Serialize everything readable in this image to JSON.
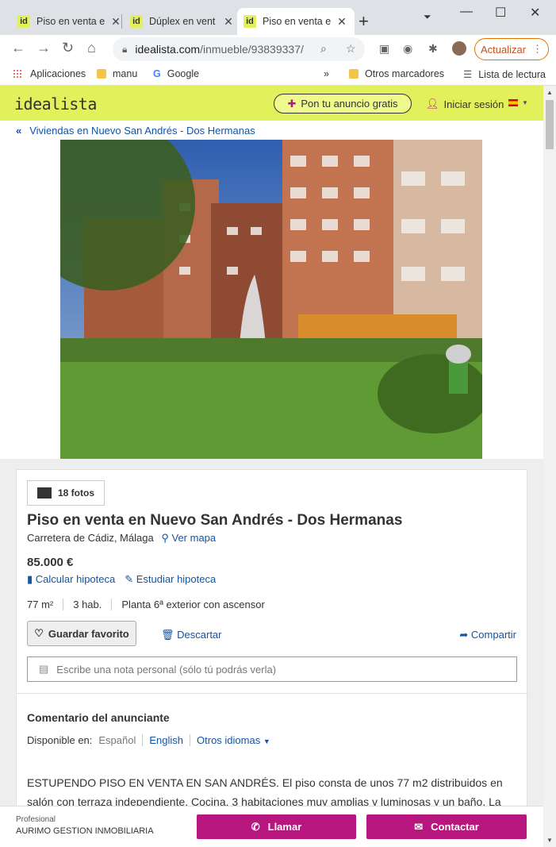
{
  "browser": {
    "tabs": [
      {
        "title": "Piso en venta e",
        "favicon": "id"
      },
      {
        "title": "Dúplex en vent",
        "favicon": "id"
      },
      {
        "title": "Piso en venta e",
        "favicon": "id"
      }
    ],
    "url_domain": "idealista.com",
    "url_path": "/inmueble/93839337/",
    "update_label": "Actualizar",
    "bookmarks": {
      "apps": "Aplicaciones",
      "manu": "manu",
      "google": "Google",
      "more": "»",
      "others": "Otros marcadores",
      "reading": "Lista de lectura"
    }
  },
  "site": {
    "logo": "idealista",
    "publish_ad": "Pon tu anuncio gratis",
    "login": "Iniciar sesión",
    "brand_color": "#e1f05b",
    "accent_color": "#b6167d"
  },
  "breadcrumb": "Viviendas en Nuevo San Andrés - Dos Hermanas",
  "listing": {
    "photos": "18 fotos",
    "title": "Piso en venta en Nuevo San Andrés - Dos Hermanas",
    "address": "Carretera de Cádiz, Málaga",
    "map_link": "Ver mapa",
    "price": "85.000 €",
    "calc_mortgage": "Calcular hipoteca",
    "study_mortgage": "Estudiar hipoteca",
    "features": [
      "77 m²",
      "3 hab.",
      "Planta 6ª exterior con ascensor"
    ],
    "save_favorite": "Guardar favorito",
    "discard": "Descartar",
    "share": "Compartir",
    "note_placeholder": "Escribe una nota personal (sólo tú podrás verla)",
    "comment_title": "Comentario del anunciante",
    "available_in": "Disponible en:",
    "lang_es": "Español",
    "lang_en": "English",
    "lang_other": "Otros idiomas",
    "description": "ESTUPENDO PISO EN VENTA EN SAN ANDRÉS. El piso consta de unos 77 m2 distribuidos en salón con terraza independiente. Cocina, 3 habitaciones muy amplias y luminosas y un baño. La vivienda su estado es a reformar"
  },
  "contact_bar": {
    "label": "Profesional",
    "agency": "AURIMO GESTION INMOBILIARIA",
    "call": "Llamar",
    "contact": "Contactar"
  }
}
